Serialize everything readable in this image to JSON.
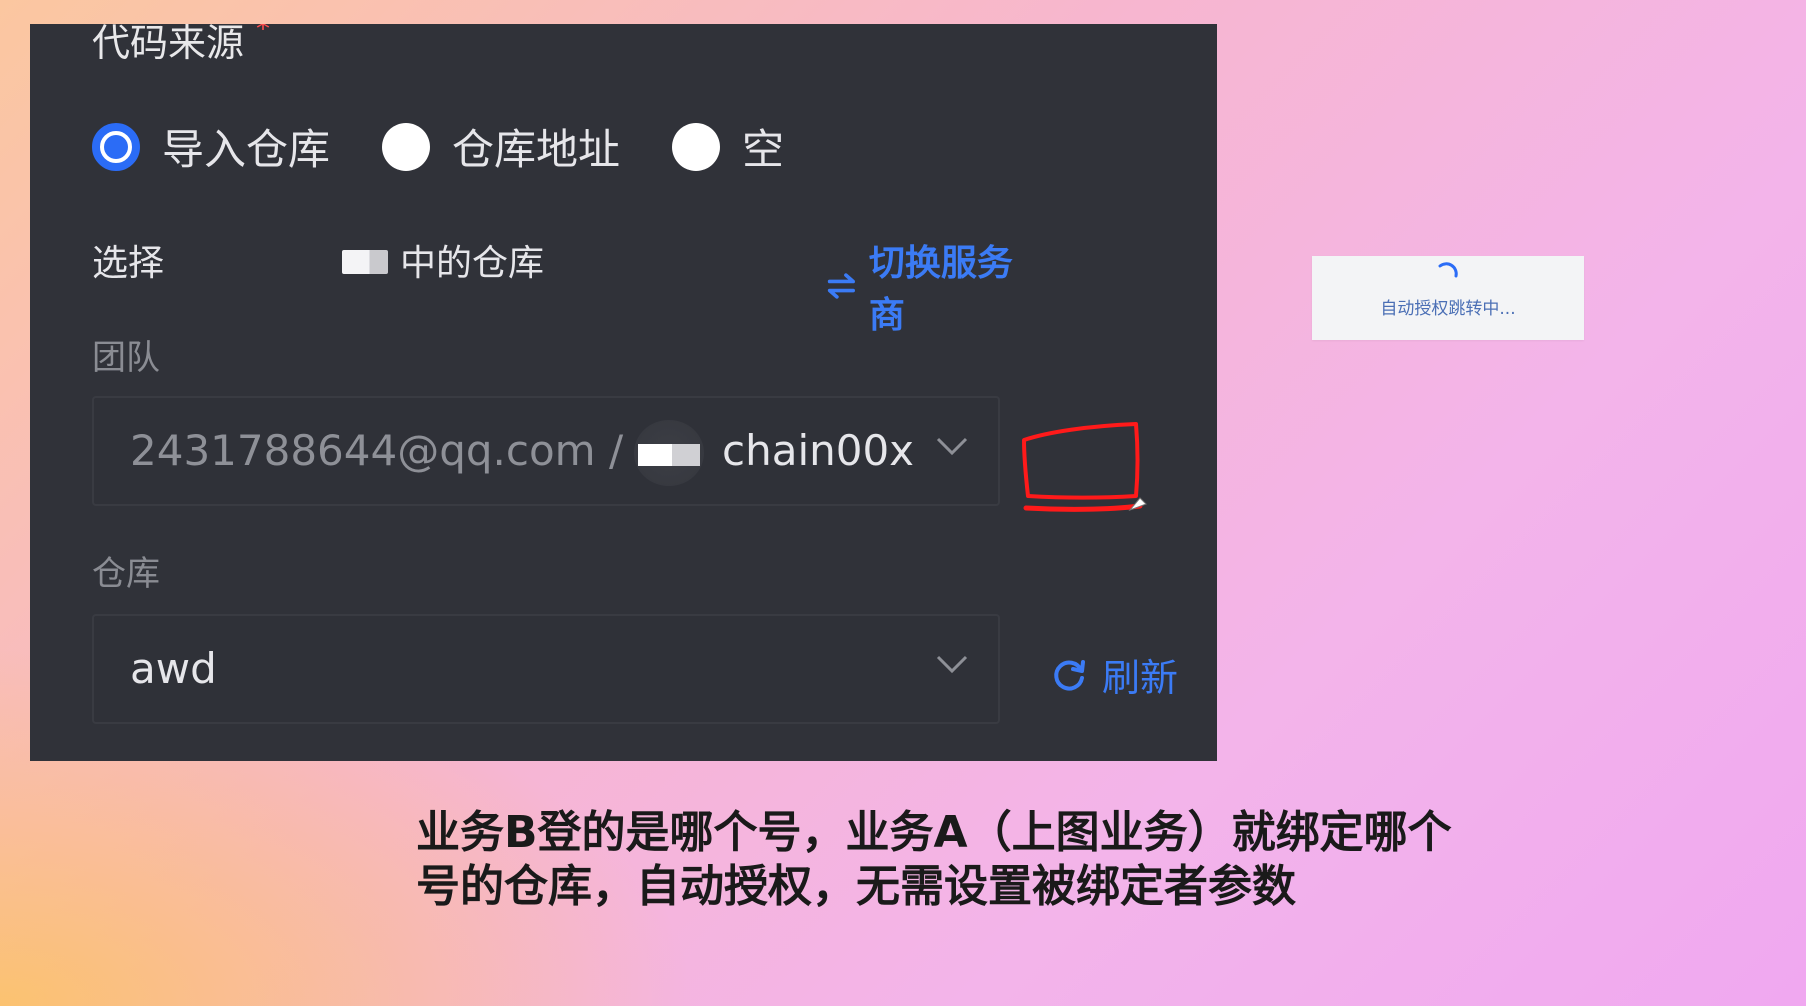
{
  "panel": {
    "section_title": "代码来源",
    "required_mark": "*",
    "radios": [
      {
        "label": "导入仓库",
        "selected": true
      },
      {
        "label": "仓库地址",
        "selected": false
      },
      {
        "label": "空",
        "selected": false
      }
    ],
    "select_prefix": "选择",
    "select_suffix": "中的仓库",
    "switch_provider": "切换服务商",
    "team_label": "团队",
    "team_account": "2431788644@qq.com /",
    "team_org": "chain00x",
    "repo_label": "仓库",
    "repo_value": "awd",
    "refresh": "刷新"
  },
  "toast": {
    "text": "自动授权跳转中..."
  },
  "caption": {
    "line1": "业务B登的是哪个号，业务A（上图业务）就绑定哪个",
    "line2": "号的仓库，自动授权，无需设置被绑定者参数"
  },
  "colors": {
    "panel_bg": "#303239",
    "accent": "#3b7bf5",
    "annotation": "#ff1a1a"
  }
}
